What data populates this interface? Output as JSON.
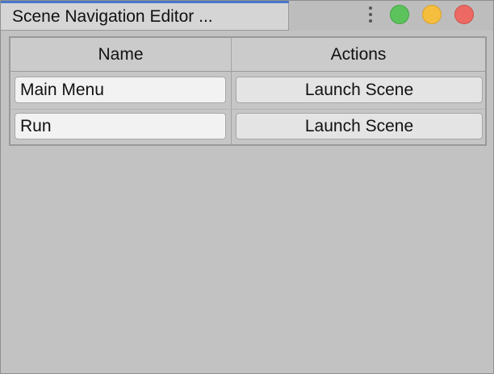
{
  "window": {
    "tab_title": "Scene Navigation Editor ...",
    "accent_color": "#4a78c8",
    "traffic_lights": [
      {
        "name": "green",
        "color": "#5cc35c"
      },
      {
        "name": "yellow",
        "color": "#f5be3f"
      },
      {
        "name": "red",
        "color": "#ec6a63"
      }
    ]
  },
  "table": {
    "columns": [
      "Name",
      "Actions"
    ],
    "rows": [
      {
        "name": "Main Menu",
        "action_label": "Launch Scene"
      },
      {
        "name": "Run",
        "action_label": "Launch Scene"
      }
    ]
  }
}
